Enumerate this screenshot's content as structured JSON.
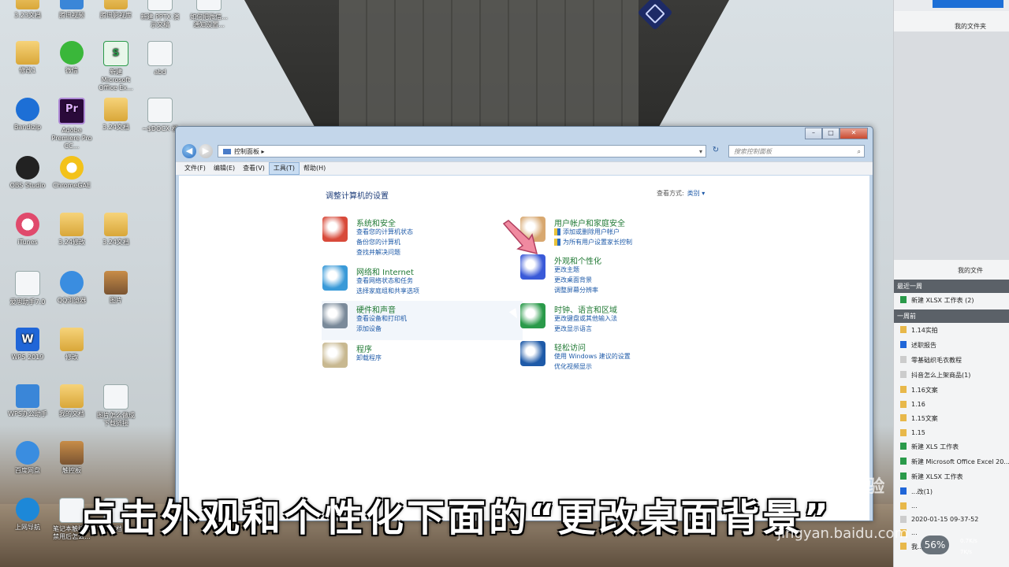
{
  "desktop": {
    "icons": [
      {
        "label": "3.23文档"
      },
      {
        "label": "腾讯视频"
      },
      {
        "label": "腾讯影视库"
      },
      {
        "label": "新建 PPTX 演示文稿"
      },
      {
        "label": "如何把微信...通知设置..."
      },
      {
        "label": "修改1"
      },
      {
        "label": "微信"
      },
      {
        "label": "新建 Microsoft Office Ex..."
      },
      {
        "label": "abd"
      },
      {
        "label": "Bandizip"
      },
      {
        "label": "Adobe Premiere Pro CC..."
      },
      {
        "label": "3.24文档"
      },
      {
        "label": "~$DOCX 档"
      },
      {
        "label": "OBS Studio"
      },
      {
        "label": "ChromeGAE"
      },
      {
        "label": "iTunes"
      },
      {
        "label": "3.24修改"
      },
      {
        "label": "3.24文档"
      },
      {
        "label": "爱思助手7.0"
      },
      {
        "label": "QQ浏览器"
      },
      {
        "label": "图片"
      },
      {
        "label": "WPS 2019"
      },
      {
        "label": "修改"
      },
      {
        "label": "WPS办公助手"
      },
      {
        "label": "我的文档"
      },
      {
        "label": "图片怎么做成下载链接"
      },
      {
        "label": "百度网盘"
      },
      {
        "label": "触控板"
      },
      {
        "label": "上网导航"
      },
      {
        "label": "笔记本触控板禁用后怎么..."
      },
      {
        "label": "文档"
      }
    ]
  },
  "window": {
    "controls": {
      "minimize": "–",
      "maximize": "□",
      "close": "✕"
    },
    "nav": {
      "back": "◀",
      "forward": "▶"
    },
    "address": "控制面板 ▸",
    "address_arrow": "▾",
    "refresh": "↻",
    "search_placeholder": "搜索控制面板",
    "search_icon": "⌕",
    "menu": [
      "文件(F)",
      "编辑(E)",
      "查看(V)",
      "工具(T)",
      "帮助(H)"
    ],
    "heading": "调整计算机的设置",
    "view_by_label": "查看方式:",
    "view_by_value": "类别 ▾",
    "categories": [
      {
        "title": "系统和安全",
        "links": [
          "查看您的计算机状态",
          "备份您的计算机",
          "查找并解决问题"
        ],
        "icon": "shield-icon"
      },
      {
        "title": "网络和 Internet",
        "links": [
          "查看网络状态和任务",
          "选择家庭组和共享选项"
        ],
        "icon": "network-icon"
      },
      {
        "title": "硬件和声音",
        "links": [
          "查看设备和打印机",
          "添加设备"
        ],
        "icon": "printer-icon"
      },
      {
        "title": "程序",
        "links": [
          "卸载程序"
        ],
        "icon": "programs-icon"
      },
      {
        "title": "用户帐户和家庭安全",
        "links": [
          "添加或删除用户帐户",
          "为所有用户设置家长控制"
        ],
        "icon": "users-icon"
      },
      {
        "title": "外观和个性化",
        "links": [
          "更改主题",
          "更改桌面背景",
          "调整屏幕分辨率"
        ],
        "icon": "display-icon"
      },
      {
        "title": "时钟、语言和区域",
        "links": [
          "更改键盘或其他输入法",
          "更改显示语言"
        ],
        "icon": "globe-clock-icon"
      },
      {
        "title": "轻松访问",
        "links": [
          "使用 Windows 建议的设置",
          "优化视频显示"
        ],
        "icon": "accessibility-icon"
      }
    ]
  },
  "right_panel": {
    "title": "我的文件夹",
    "title2": "我的文件",
    "groups": [
      {
        "label": "最近一周",
        "items": [
          {
            "name": "新建 XLSX 工作表 (2)",
            "type": "x"
          }
        ]
      },
      {
        "label": "一周前",
        "items": [
          {
            "name": "1.14实拍",
            "type": "f"
          },
          {
            "name": "述职报告",
            "type": "w"
          },
          {
            "name": "零基础织毛衣教程",
            "type": "d"
          },
          {
            "name": "抖音怎么上架商品(1)",
            "type": "d"
          },
          {
            "name": "1.16文案",
            "type": "f"
          },
          {
            "name": "1.16",
            "type": "f"
          },
          {
            "name": "1.15文案",
            "type": "f"
          },
          {
            "name": "1.15",
            "type": "f"
          },
          {
            "name": "新建 XLS 工作表",
            "type": "x"
          },
          {
            "name": "新建 Microsoft Office Excel 20...",
            "type": "x"
          },
          {
            "name": "新建 XLSX 工作表",
            "type": "x"
          },
          {
            "name": "...改(1)",
            "type": "w"
          },
          {
            "name": "...",
            "type": "f"
          },
          {
            "name": "2020-01-15 09-37-52",
            "type": "d"
          },
          {
            "name": "...",
            "type": "f"
          },
          {
            "name": "我...",
            "type": "f"
          }
        ]
      }
    ]
  },
  "caption": "点击外观和个性化下面的“更改桌面背景”",
  "watermark": "Baidu 经验",
  "watermark_url": "jingyan.baidu.com",
  "net_speed": {
    "percent": "56%",
    "up": "0.7K/s",
    "down": "7K/s"
  }
}
